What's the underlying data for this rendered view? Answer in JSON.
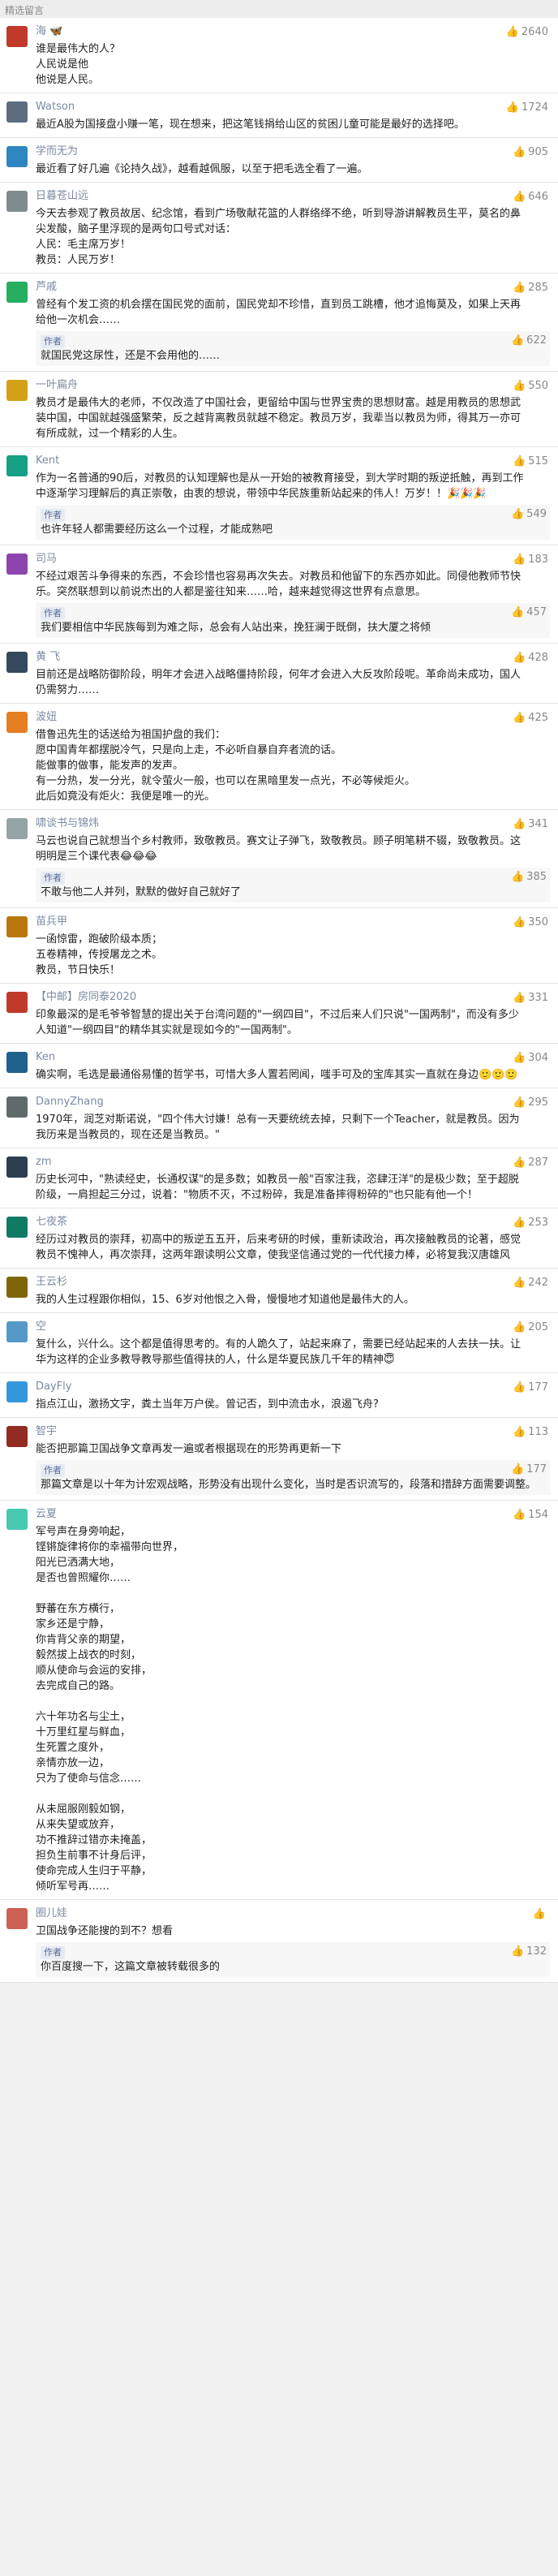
{
  "header": "精选留言",
  "comments": [
    {
      "name": "海 🦋",
      "likes": "2640",
      "color": "#c0392b",
      "text": "谁是最伟大的人？\n人民说是他\n他说是人民。"
    },
    {
      "name": "Watson",
      "likes": "1724",
      "color": "#5d6d7e",
      "text": "最近A股为国接盘小赚一笔，现在想来，把这笔钱捐给山区的贫困儿童可能是最好的选择吧。"
    },
    {
      "name": "学而无为",
      "likes": "905",
      "color": "#2e86c1",
      "text": "最近看了好几遍《论持久战》，越看越佩服，以至于把毛选全看了一遍。"
    },
    {
      "name": "日暮苍山远",
      "likes": "646",
      "color": "#7f8c8d",
      "text": "今天去参观了教员故居、纪念馆，看到广场敬献花篮的人群络绎不绝，听到导游讲解教员生平，莫名的鼻尖发酸，脑子里浮现的是两句口号式对话：\n人民：毛主席万岁！\n教员：人民万岁！"
    },
    {
      "name": "芦戚",
      "likes": "285",
      "color": "#27ae60",
      "text": "曾经有个发工资的机会摆在国民党的面前，国民党却不珍惜，直到员工跳槽，他才追悔莫及，如果上天再给他一次机会……",
      "reply": {
        "name": "作者",
        "likes": "622",
        "text": "就国民党这尿性，还是不会用他的……"
      }
    },
    {
      "name": "一叶扁舟",
      "likes": "550",
      "color": "#d4a017",
      "text": "教员才是最伟大的老师，不仅改造了中国社会，更留给中国与世界宝贵的思想财富。越是用教员的思想武装中国，中国就越强盛繁荣，反之越背离教员就越不稳定。教员万岁，我辈当以教员为师，得其万一亦可有所成就，过一个精彩的人生。"
    },
    {
      "name": "Kent",
      "likes": "515",
      "color": "#16a085",
      "text": "作为一名普通的90后，对教员的认知理解也是从一开始的被教育接受，到大学时期的叛逆抵触，再到工作中逐渐学习理解后的真正崇敬，由衷的想说，带领中华民族重新站起来的伟人！万岁！！🎉🎉🎉",
      "reply": {
        "name": "作者",
        "likes": "549",
        "text": "也许年轻人都需要经历这么一个过程，才能成熟吧"
      }
    },
    {
      "name": "司马",
      "likes": "183",
      "color": "#8e44ad",
      "text": "不经过艰苦斗争得来的东西，不会珍惜也容易再次失去。对教员和他留下的东西亦如此。同侵他教师节快乐。突然联想到以前说杰出的人都是鉴往知来……哈，越来越觉得这世界有点意思。",
      "reply": {
        "name": "作者",
        "likes": "457",
        "text": "我们要相信中华民族每到为难之际，总会有人站出来，挽狂澜于既倒，扶大厦之将倾"
      }
    },
    {
      "name": "黄 飞",
      "likes": "428",
      "color": "#34495e",
      "text": "目前还是战略防御阶段，明年才会进入战略僵持阶段，何年才会进入大反攻阶段呢。革命尚未成功，国人仍需努力……"
    },
    {
      "name": "波妞",
      "likes": "425",
      "color": "#e67e22",
      "text": "借鲁迅先生的话送给为祖国护盘的我们：\n愿中国青年都摆脱冷气，只是向上走，不必听自暴自弃者流的话。\n能做事的做事，能发声的发声。\n有一分热，发一分光，就令萤火一般，也可以在黑暗里发一点光，不必等候炬火。\n此后如竟没有炬火：我便是唯一的光。"
    },
    {
      "name": "啸谈书与锦炜",
      "likes": "341",
      "color": "#95a5a6",
      "text": "马云也说自己就想当个乡村教师，致敬教员。赛文让子弹飞，致敬教员。顾子明笔耕不辍，致敬教员。这明明是三个课代表😂😂😂",
      "reply": {
        "name": "作者",
        "likes": "385",
        "text": "不敢与他二人并列，默默的做好自己就好了"
      }
    },
    {
      "name": "苗兵甲",
      "likes": "350",
      "color": "#b9770e",
      "text": "一函惊雷，跑破阶级本质；\n五卷精神，传授屠龙之术。\n教员，节日快乐！"
    },
    {
      "name": "【中邮】房同泰2020",
      "likes": "331",
      "color": "#c0392b",
      "text": "印象最深的是毛爷爷智慧的提出关于台湾问题的\"一纲四目\"，不过后来人们只说\"一国两制\"，而没有多少人知道\"一纲四目\"的精华其实就是现如今的\"一国两制\"。"
    },
    {
      "name": "Ken",
      "likes": "304",
      "color": "#1f618d",
      "text": "确实啊，毛选是最通俗易懂的哲学书，可惜大多人置若罔闻，嗤手可及的宝库其实一直就在身边🙂🙂🙂"
    },
    {
      "name": "DannyZhang",
      "likes": "295",
      "color": "#616a6b",
      "text": "1970年，润芝对斯诺说，\"四个伟大讨嫌！总有一天要统统去掉，只剩下一个Teacher，就是教员。因为我历来是当教员的，现在还是当教员。\""
    },
    {
      "name": "zm",
      "likes": "287",
      "color": "#2c3e50",
      "text": "历史长河中，\"熟读经史，长通权谋\"的是多数；如教员一般\"百家注我，恣肆汪洋\"的是极少数；至于超脱阶级，一肩担起三分过，说着：\"物质不灭，不过粉碎，我是准备摔得粉碎的\"也只能有他一个！"
    },
    {
      "name": "七夜茶",
      "likes": "253",
      "color": "#117a65",
      "text": "经历过对教员的崇拜，初高中的叛逆五五开，后来考研的时候，重新读政治，再次接触教员的论著，感觉教员不愧神人，再次崇拜，这两年跟读明公文章，使我坚信通过党的一代代接力棒，必将复我汉唐雄风"
    },
    {
      "name": "王云杉",
      "likes": "242",
      "color": "#7d6608",
      "text": "我的人生过程跟你相似，15、6岁对他恨之入骨，慢慢地才知道他是最伟大的人。"
    },
    {
      "name": "空",
      "likes": "205",
      "color": "#5499c7",
      "text": "复什么，兴什么。这个都是值得思考的。有的人跪久了，站起来麻了，需要已经站起来的人去扶一扶。让华为这样的企业多教导教导那些值得扶的人，什么是华夏民族几千年的精神😇"
    },
    {
      "name": "DayFly",
      "likes": "177",
      "color": "#3498db",
      "text": "指点江山，激扬文字，粪土当年万户侯。曾记否，到中流击水，浪遏飞舟?"
    },
    {
      "name": "智宇",
      "likes": "113",
      "color": "#922b21",
      "text": "能否把那篇卫国战争文章再发一遍或者根据现在的形势再更新一下",
      "reply": {
        "name": "作者",
        "likes": "177",
        "text": "那篇文章是以十年为计宏观战略，形势没有出现什么变化，当时是否识流写的，段落和措辞方面需要调整。"
      }
    },
    {
      "name": "云夏",
      "likes": "154",
      "color": "#48c9b0",
      "text": "军号声在身旁响起，\n铿锵旋律将你的幸福带向世界，\n阳光已洒满大地，\n是否也曾照耀你……\n\n野蕃在东方横行，\n家乡还是宁静，\n你肯背父亲的期望，\n毅然拔上战衣的时刻，\n顺从使命与会运的安排，\n去完成自己的路。\n\n六十年功名与尘土，\n十万里红星与鲜血，\n生死置之度外，\n亲情亦放一边，\n只为了使命与信念……\n\n从未屈服刚毅如钢，\n从来失望或放弃，\n功不推辞过错亦未掩盖，\n担负生前事不计身后评，\n使命完成人生归于平静，\n倾听军号再……"
    },
    {
      "name": "圈儿娃",
      "likes": "",
      "color": "#cd6155",
      "text": "卫国战争还能搜的到不？想看",
      "reply": {
        "name": "作者",
        "likes": "132",
        "text": "你百度搜一下，这篇文章被转载很多的"
      }
    }
  ]
}
